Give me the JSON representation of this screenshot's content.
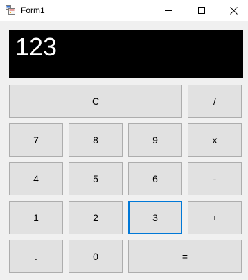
{
  "window": {
    "title": "Form1",
    "icons": {
      "app": "app-icon",
      "minimize": "minimize-icon",
      "maximize": "maximize-icon",
      "close": "close-icon"
    }
  },
  "display": {
    "value": "123",
    "background": "#000000",
    "color": "#ffffff"
  },
  "keys": {
    "clear": "C",
    "divide": "/",
    "seven": "7",
    "eight": "8",
    "nine": "9",
    "multiply": "x",
    "four": "4",
    "five": "5",
    "six": "6",
    "subtract": "-",
    "one": "1",
    "two": "2",
    "three": "3",
    "add": "+",
    "decimal": ".",
    "zero": "0",
    "equals": "="
  },
  "colors": {
    "button_face": "#e1e1e1",
    "button_border": "#adadad",
    "focus_border": "#0078d7",
    "window_bg": "#f0f0f0"
  }
}
